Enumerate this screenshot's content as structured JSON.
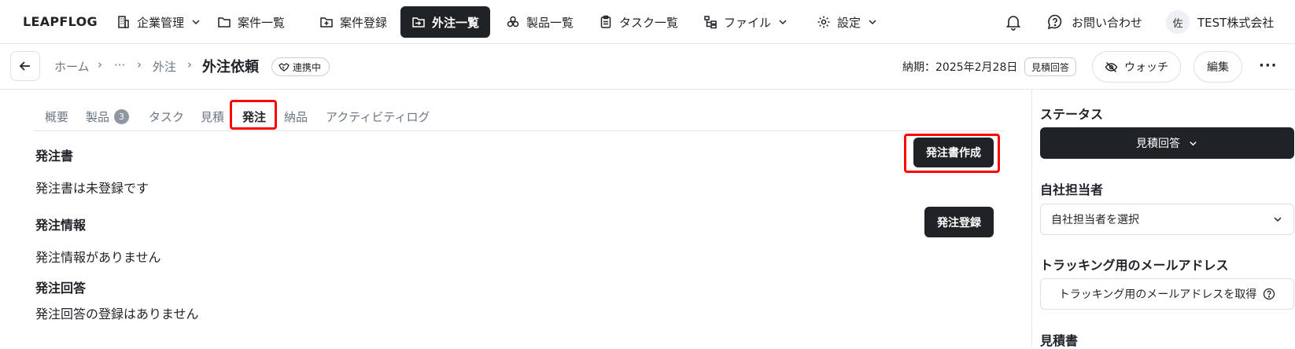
{
  "brand": "LEAPFLOG",
  "nav": {
    "items": [
      {
        "label": "企業管理",
        "icon": "building-icon"
      },
      {
        "label": "案件一覧",
        "icon": "folder-icon"
      },
      {
        "label": "案件登録",
        "icon": "folder-plus-icon"
      },
      {
        "label": "外注一覧",
        "icon": "folder-out-icon"
      },
      {
        "label": "製品一覧",
        "icon": "cubes-icon"
      },
      {
        "label": "タスク一覧",
        "icon": "clipboard-icon"
      },
      {
        "label": "ファイル",
        "icon": "file-tree-icon"
      },
      {
        "label": "設定",
        "icon": "gear-icon"
      }
    ],
    "active": "外注一覧",
    "contact_label": "お問い合わせ",
    "avatar_initial": "佐",
    "company": "TEST株式会社"
  },
  "subheader": {
    "breadcrumb": [
      "ホーム",
      "···",
      "外注"
    ],
    "title": "外注依頼",
    "link_badge": "連携中",
    "due": "納期：2025年2月28日",
    "status_badge": "見積回答",
    "watch_label": "ウォッチ",
    "edit_label": "編集",
    "more": "···"
  },
  "tabs": [
    {
      "label": "概要"
    },
    {
      "label": "製品",
      "count": "3"
    },
    {
      "label": "タスク"
    },
    {
      "label": "見積"
    },
    {
      "label": "発注"
    },
    {
      "label": "納品"
    },
    {
      "label": "アクティビティログ"
    }
  ],
  "active_tab": "発注",
  "main": {
    "order_doc": {
      "title": "発注書",
      "empty": "発注書は未登録です",
      "button": "発注書作成"
    },
    "order_info": {
      "title": "発注情報",
      "empty": "発注情報がありません",
      "button": "発注登録"
    },
    "order_reply": {
      "title": "発注回答",
      "empty": "発注回答の登録はありません"
    }
  },
  "sidebar": {
    "status": {
      "title": "ステータス",
      "value": "見積回答"
    },
    "assignee": {
      "title": "自社担当者",
      "placeholder": "自社担当者を選択"
    },
    "tracking": {
      "title": "トラッキング用のメールアドレス",
      "button": "トラッキング用のメールアドレスを取得"
    },
    "quote": {
      "title": "見積書"
    }
  },
  "colors": {
    "dark": "#1f2326",
    "highlight": "#ff0000",
    "muted": "#6b7684",
    "border": "#e4e6e9"
  }
}
